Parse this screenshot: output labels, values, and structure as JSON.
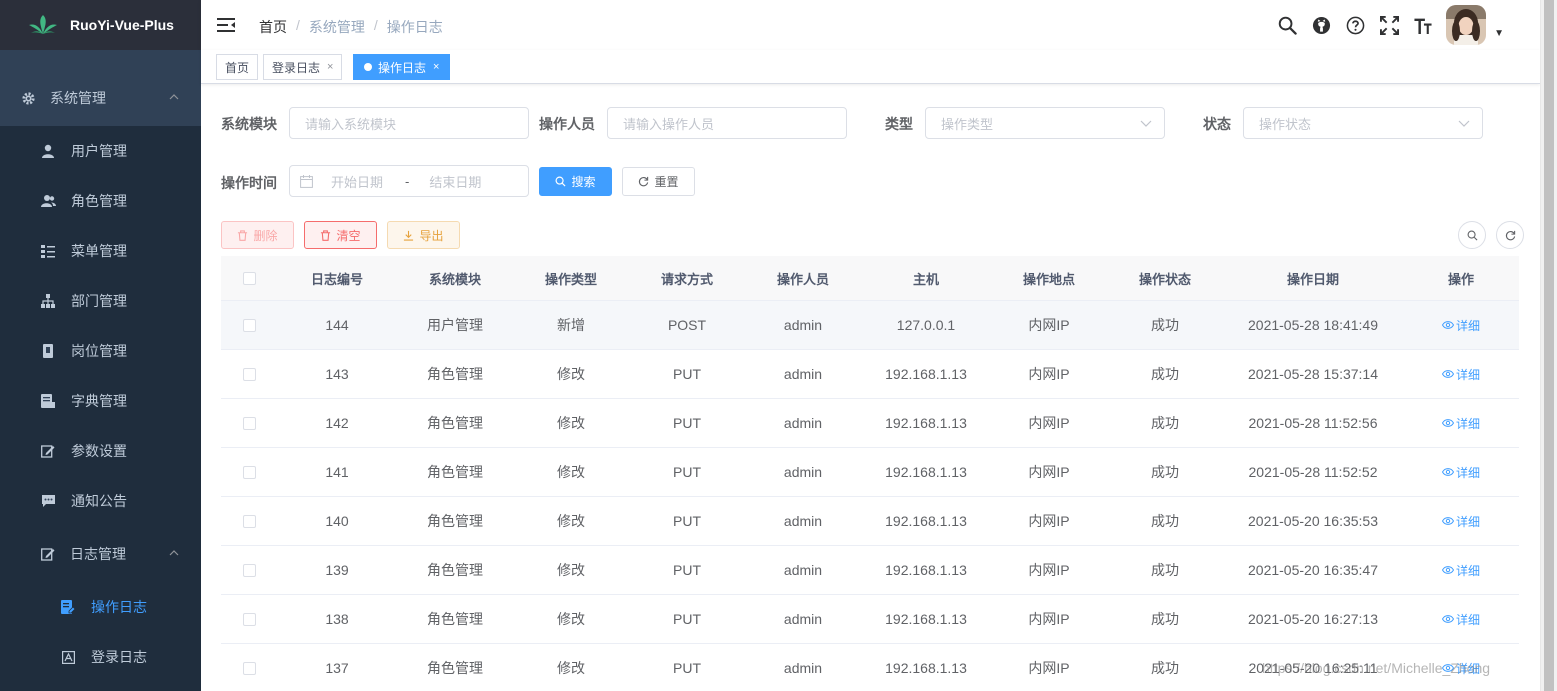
{
  "app": {
    "title": "RuoYi-Vue-Plus"
  },
  "sidebar": {
    "group1": {
      "label": "系统管理",
      "icon": "gear-icon"
    },
    "items": [
      {
        "label": "用户管理",
        "icon": "user-icon"
      },
      {
        "label": "角色管理",
        "icon": "peoples-icon"
      },
      {
        "label": "菜单管理",
        "icon": "tree-table-icon"
      },
      {
        "label": "部门管理",
        "icon": "tree-icon"
      },
      {
        "label": "岗位管理",
        "icon": "post-icon"
      },
      {
        "label": "字典管理",
        "icon": "dict-icon"
      },
      {
        "label": "参数设置",
        "icon": "edit-icon"
      },
      {
        "label": "通知公告",
        "icon": "message-icon"
      }
    ],
    "group2": {
      "label": "日志管理",
      "icon": "log-icon"
    },
    "sub_items": [
      {
        "label": "操作日志",
        "icon": "form-icon",
        "active": true
      },
      {
        "label": "登录日志",
        "icon": "logininfor-icon"
      }
    ]
  },
  "navbar": {
    "breadcrumb": [
      "首页",
      "系统管理",
      "操作日志"
    ],
    "icons": [
      "search-icon",
      "github-icon",
      "question-icon",
      "fullscreen-icon",
      "font-size-icon"
    ]
  },
  "tags": [
    {
      "label": "首页"
    },
    {
      "label": "登录日志",
      "close": "×"
    },
    {
      "label": "操作日志",
      "close": "×",
      "active": true
    }
  ],
  "form": {
    "module": {
      "label": "系统模块",
      "placeholder": "请输入系统模块"
    },
    "operator": {
      "label": "操作人员",
      "placeholder": "请输入操作人员"
    },
    "type": {
      "label": "类型",
      "placeholder": "操作类型"
    },
    "status": {
      "label": "状态",
      "placeholder": "操作状态"
    },
    "time": {
      "label": "操作时间",
      "start": "开始日期",
      "sep": "-",
      "end": "结束日期"
    },
    "search_btn": "搜索",
    "reset_btn": "重置"
  },
  "toolbar": {
    "delete": "删除",
    "clean": "清空",
    "export": "导出"
  },
  "table": {
    "headers": [
      "日志编号",
      "系统模块",
      "操作类型",
      "请求方式",
      "操作人员",
      "主机",
      "操作地点",
      "操作状态",
      "操作日期",
      "操作"
    ],
    "action_label": "详细",
    "rows": [
      [
        "144",
        "用户管理",
        "新增",
        "POST",
        "admin",
        "127.0.0.1",
        "内网IP",
        "成功",
        "2021-05-28 18:41:49"
      ],
      [
        "143",
        "角色管理",
        "修改",
        "PUT",
        "admin",
        "192.168.1.13",
        "内网IP",
        "成功",
        "2021-05-28 15:37:14"
      ],
      [
        "142",
        "角色管理",
        "修改",
        "PUT",
        "admin",
        "192.168.1.13",
        "内网IP",
        "成功",
        "2021-05-28 11:52:56"
      ],
      [
        "141",
        "角色管理",
        "修改",
        "PUT",
        "admin",
        "192.168.1.13",
        "内网IP",
        "成功",
        "2021-05-28 11:52:52"
      ],
      [
        "140",
        "角色管理",
        "修改",
        "PUT",
        "admin",
        "192.168.1.13",
        "内网IP",
        "成功",
        "2021-05-20 16:35:53"
      ],
      [
        "139",
        "角色管理",
        "修改",
        "PUT",
        "admin",
        "192.168.1.13",
        "内网IP",
        "成功",
        "2021-05-20 16:35:47"
      ],
      [
        "138",
        "角色管理",
        "修改",
        "PUT",
        "admin",
        "192.168.1.13",
        "内网IP",
        "成功",
        "2021-05-20 16:27:13"
      ],
      [
        "137",
        "角色管理",
        "修改",
        "PUT",
        "admin",
        "192.168.1.13",
        "内网IP",
        "成功",
        "2021-05-20 16:25:11"
      ]
    ]
  },
  "watermark": "https://blog.csdn.net/Michelle_Zhong",
  "colors": {
    "sidebar": "#304156",
    "logo_bar": "#2b2f3a",
    "submenu": "#1f2d3d",
    "primary": "#409eff",
    "danger": "#f56c6c",
    "warning": "#e6a23c"
  }
}
